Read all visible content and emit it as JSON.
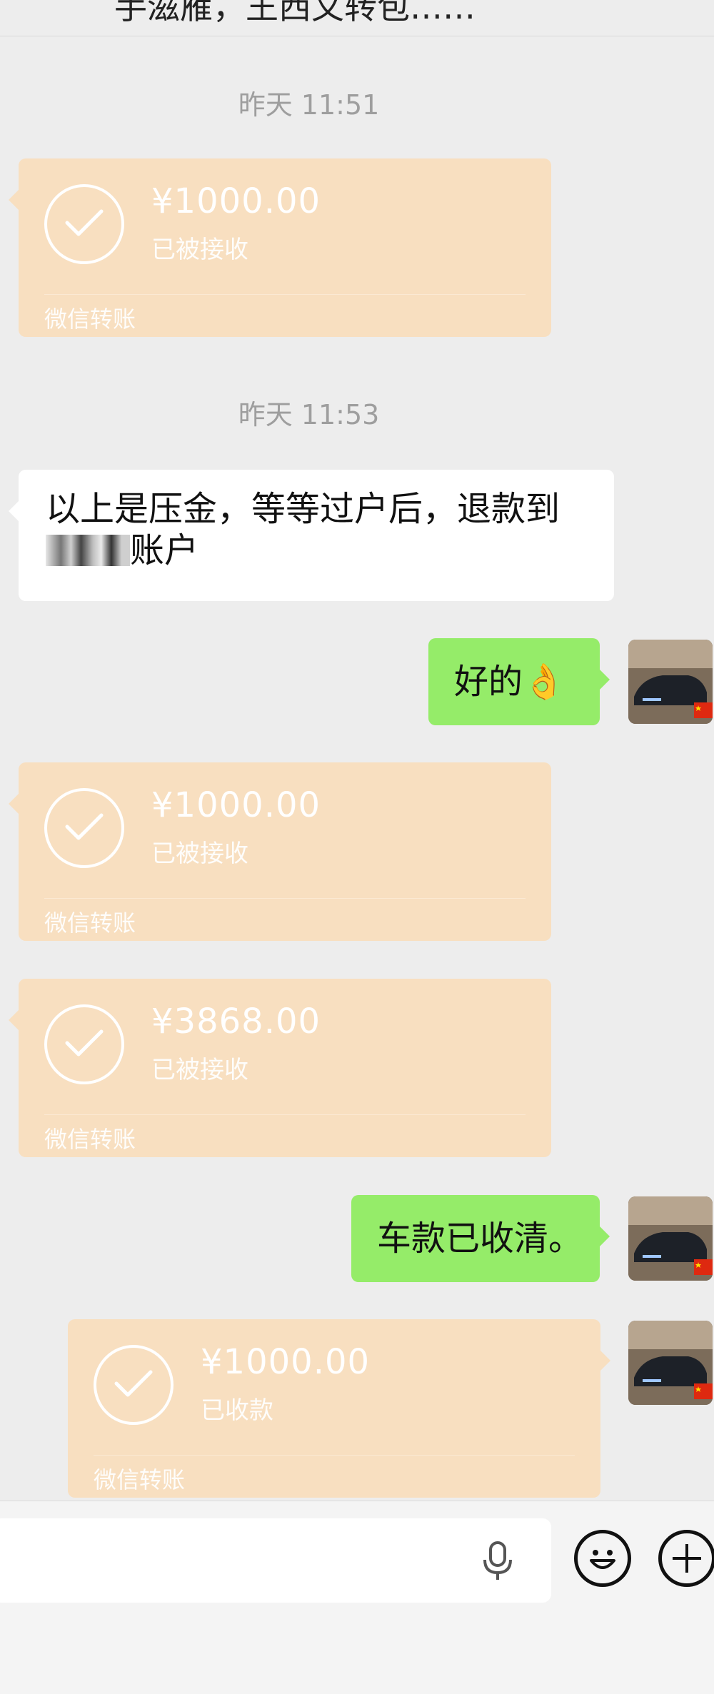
{
  "header": {
    "partial_text": "手滋雁，王西文转包……"
  },
  "messages": [
    {
      "type": "timestamp",
      "text": "昨天 11:51"
    },
    {
      "type": "transfer",
      "side": "left",
      "amount": "¥1000.00",
      "status": "已被接收",
      "label": "微信转账"
    },
    {
      "type": "timestamp",
      "text": "昨天 11:53"
    },
    {
      "type": "text",
      "side": "left",
      "line1": "以上是压金，等等过户后，退款到",
      "line2": "账户"
    },
    {
      "type": "text",
      "side": "right",
      "text": "好的👌"
    },
    {
      "type": "transfer",
      "side": "left",
      "amount": "¥1000.00",
      "status": "已被接收",
      "label": "微信转账"
    },
    {
      "type": "transfer",
      "side": "left",
      "amount": "¥3868.00",
      "status": "已被接收",
      "label": "微信转账"
    },
    {
      "type": "text",
      "side": "right",
      "text": "车款已收清。"
    },
    {
      "type": "transfer",
      "side": "right",
      "amount": "¥1000.00",
      "status": "已收款",
      "label": "微信转账"
    }
  ],
  "icons": {
    "check": "check-icon",
    "mic": "microphone-icon",
    "emoji": "emoji-icon",
    "plus": "plus-icon",
    "avatar_flag": "china-flag"
  },
  "colors": {
    "background": "#ededed",
    "transfer_card": "#f8dfc0",
    "green_bubble": "#95ec69",
    "white_bubble": "#ffffff",
    "timestamp": "#9e9e9e"
  }
}
